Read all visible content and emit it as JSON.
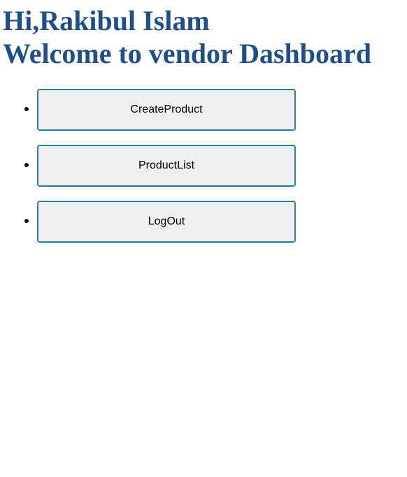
{
  "header": {
    "greeting_line1": "Hi,Rakibul Islam",
    "greeting_line2": "Welcome to vendor Dashboard",
    "color": "#1f4e8c"
  },
  "menu": {
    "items": [
      {
        "label": "CreateProduct"
      },
      {
        "label": "ProductList"
      },
      {
        "label": "LogOut"
      }
    ],
    "button_border_color": "#2a7f9c",
    "button_background": "#efefef"
  }
}
